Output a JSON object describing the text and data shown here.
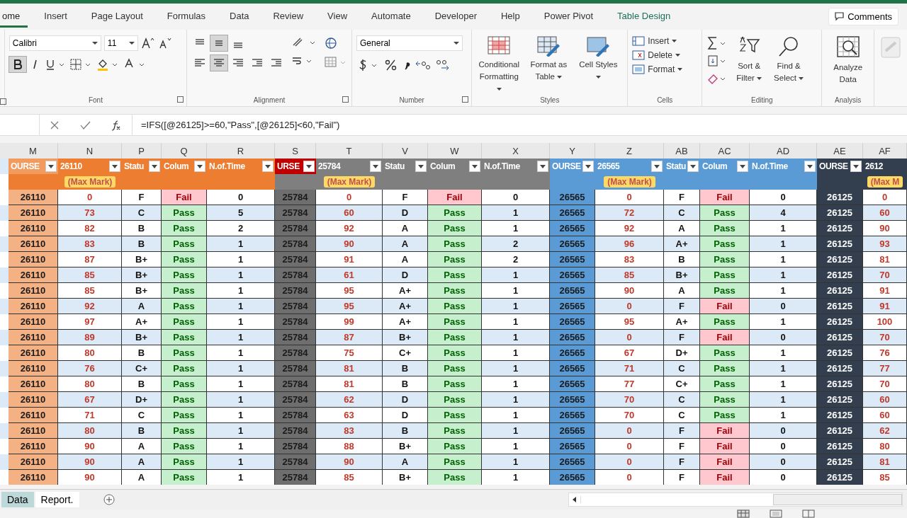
{
  "ribbon": {
    "tabs": [
      {
        "label": "ome",
        "selected": true
      },
      {
        "label": "Insert",
        "selected": false
      },
      {
        "label": "Page Layout",
        "selected": false
      },
      {
        "label": "Formulas",
        "selected": false
      },
      {
        "label": "Data",
        "selected": false
      },
      {
        "label": "Review",
        "selected": false
      },
      {
        "label": "View",
        "selected": false
      },
      {
        "label": "Automate",
        "selected": false
      },
      {
        "label": "Developer",
        "selected": false
      },
      {
        "label": "Help",
        "selected": false
      },
      {
        "label": "Power Pivot",
        "selected": false
      },
      {
        "label": "Table Design",
        "selected": false
      }
    ],
    "comments_button": "Comments",
    "font": {
      "label": "Font",
      "name": "Calibri",
      "size": "11",
      "bold": true
    },
    "alignment": {
      "label": "Alignment",
      "buttons": [
        {
          "kind": "top",
          "selected": false
        },
        {
          "kind": "middle",
          "selected": true
        },
        {
          "kind": "bottom",
          "selected": false
        },
        {
          "kind": "left",
          "selected": false
        },
        {
          "kind": "center",
          "selected": true
        },
        {
          "kind": "right",
          "selected": false
        },
        {
          "kind": "outdent",
          "selected": false
        },
        {
          "kind": "indent",
          "selected": false
        }
      ]
    },
    "number": {
      "label": "Number",
      "format": "General"
    },
    "styles": {
      "label": "Styles",
      "buttons": [
        {
          "kind": "conditional",
          "label": "Conditional Formatting"
        },
        {
          "kind": "table",
          "label": "Format as Table"
        },
        {
          "kind": "cellstyles",
          "label": "Cell Styles"
        }
      ]
    },
    "cells": {
      "label": "Cells",
      "buttons": [
        {
          "kind": "insert",
          "label": "Insert"
        },
        {
          "kind": "delete",
          "label": "Delete"
        },
        {
          "kind": "format",
          "label": "Format"
        }
      ]
    },
    "editing": {
      "label": "Editing",
      "buttons": [
        {
          "kind": "sort",
          "label": "Sort & Filter"
        },
        {
          "kind": "find",
          "label": "Find & Select"
        }
      ]
    },
    "analysis": {
      "label": "Analysis",
      "button": "Analyze Data"
    }
  },
  "formula_bar": {
    "formula": "=IFS([@26125]>=60,\"Pass\",[@26125]<60,\"Fail\")"
  },
  "table": {
    "blocks": [
      {
        "color": "#ed7d31",
        "code_column": {
          "color": "#f4b183"
        },
        "letters": [
          "M",
          "N",
          "P",
          "Q",
          "R"
        ],
        "headers": [
          {
            "label": "OURSE",
            "color": "#f29b5e",
            "filter": true
          },
          {
            "label": "26110",
            "color": "#ed7d31",
            "filter": true
          },
          {
            "label": "Statu",
            "color": "#ed7d31",
            "filter": true
          },
          {
            "label": "Colum",
            "color": "#ed7d31",
            "filter": true
          },
          {
            "label": "N.of.Time",
            "color": "#ed7d31",
            "filter": true
          }
        ],
        "subheader": "(Max Mark)"
      },
      {
        "color": "#7f7f7f",
        "code_column": {
          "color": "#6e6e6e"
        },
        "letters": [
          "S",
          "T",
          "V",
          "W",
          "X"
        ],
        "headers": [
          {
            "label": "URSE",
            "color": "#c00000",
            "filter": true
          },
          {
            "label": "25784",
            "color": "#7f7f7f",
            "filter": true
          },
          {
            "label": "Statu",
            "color": "#7f7f7f",
            "filter": true
          },
          {
            "label": "Colum",
            "color": "#7f7f7f",
            "filter": true
          },
          {
            "label": "N.of.Time",
            "color": "#7f7f7f",
            "filter": true
          }
        ],
        "subheader": "(Max Mark)"
      },
      {
        "color": "#5b9bd5",
        "code_column": {
          "color": "#5b9bd5"
        },
        "letters": [
          "Y",
          "Z",
          "AB",
          "AC",
          "AD"
        ],
        "headers": [
          {
            "label": "OURSE",
            "color": "#5b9bd5",
            "filter": true
          },
          {
            "label": "26565",
            "color": "#5b9bd5",
            "filter": true
          },
          {
            "label": "Statu",
            "color": "#5b9bd5",
            "filter": true
          },
          {
            "label": "Colum",
            "color": "#5b9bd5",
            "filter": true
          },
          {
            "label": "N.of.Time",
            "color": "#5b9bd5",
            "filter": true
          }
        ],
        "subheader": "(Max Mark)"
      },
      {
        "color": "#333f4f",
        "code_column": {
          "color": "#333f4f"
        },
        "letters": [
          "AE",
          "AF"
        ],
        "headers": [
          {
            "label": "OURSE",
            "color": "#333f4f",
            "filter": true
          },
          {
            "label": "2612",
            "color": "#333f4f",
            "filter": false
          }
        ],
        "subheader": "(Max M"
      }
    ],
    "rows": [
      {
        "groups": [
          {
            "code": "26110",
            "mark": "0",
            "grade": "F",
            "result": "Fail",
            "pass": false,
            "times": "0"
          },
          {
            "code": "25784",
            "mark": "0",
            "grade": "F",
            "result": "Fail",
            "pass": false,
            "times": "0"
          },
          {
            "code": "26565",
            "mark": "0",
            "grade": "F",
            "result": "Fail",
            "pass": false,
            "times": "0"
          },
          {
            "code": "26125",
            "mark": "0"
          }
        ]
      },
      {
        "groups": [
          {
            "code": "26110",
            "mark": "73",
            "grade": "C",
            "result": "Pass",
            "pass": true,
            "times": "5"
          },
          {
            "code": "25784",
            "mark": "60",
            "grade": "D",
            "result": "Pass",
            "pass": true,
            "times": "1"
          },
          {
            "code": "26565",
            "mark": "72",
            "grade": "C",
            "result": "Pass",
            "pass": true,
            "times": "4"
          },
          {
            "code": "26125",
            "mark": "60"
          }
        ]
      },
      {
        "groups": [
          {
            "code": "26110",
            "mark": "82",
            "grade": "B",
            "result": "Pass",
            "pass": true,
            "times": "2"
          },
          {
            "code": "25784",
            "mark": "92",
            "grade": "A",
            "result": "Pass",
            "pass": true,
            "times": "1"
          },
          {
            "code": "26565",
            "mark": "92",
            "grade": "A",
            "result": "Pass",
            "pass": true,
            "times": "1"
          },
          {
            "code": "26125",
            "mark": "90"
          }
        ]
      },
      {
        "groups": [
          {
            "code": "26110",
            "mark": "83",
            "grade": "B",
            "result": "Pass",
            "pass": true,
            "times": "1"
          },
          {
            "code": "25784",
            "mark": "90",
            "grade": "A",
            "result": "Pass",
            "pass": true,
            "times": "2"
          },
          {
            "code": "26565",
            "mark": "96",
            "grade": "A+",
            "result": "Pass",
            "pass": true,
            "times": "1"
          },
          {
            "code": "26125",
            "mark": "93"
          }
        ]
      },
      {
        "groups": [
          {
            "code": "26110",
            "mark": "87",
            "grade": "B+",
            "result": "Pass",
            "pass": true,
            "times": "1"
          },
          {
            "code": "25784",
            "mark": "91",
            "grade": "A",
            "result": "Pass",
            "pass": true,
            "times": "2"
          },
          {
            "code": "26565",
            "mark": "83",
            "grade": "B",
            "result": "Pass",
            "pass": true,
            "times": "1"
          },
          {
            "code": "26125",
            "mark": "81"
          }
        ]
      },
      {
        "groups": [
          {
            "code": "26110",
            "mark": "85",
            "grade": "B+",
            "result": "Pass",
            "pass": true,
            "times": "1"
          },
          {
            "code": "25784",
            "mark": "61",
            "grade": "D",
            "result": "Pass",
            "pass": true,
            "times": "1"
          },
          {
            "code": "26565",
            "mark": "85",
            "grade": "B+",
            "result": "Pass",
            "pass": true,
            "times": "1"
          },
          {
            "code": "26125",
            "mark": "70"
          }
        ]
      },
      {
        "groups": [
          {
            "code": "26110",
            "mark": "85",
            "grade": "B+",
            "result": "Pass",
            "pass": true,
            "times": "1"
          },
          {
            "code": "25784",
            "mark": "95",
            "grade": "A+",
            "result": "Pass",
            "pass": true,
            "times": "1"
          },
          {
            "code": "26565",
            "mark": "90",
            "grade": "A",
            "result": "Pass",
            "pass": true,
            "times": "1"
          },
          {
            "code": "26125",
            "mark": "91"
          }
        ]
      },
      {
        "groups": [
          {
            "code": "26110",
            "mark": "92",
            "grade": "A",
            "result": "Pass",
            "pass": true,
            "times": "1"
          },
          {
            "code": "25784",
            "mark": "95",
            "grade": "A+",
            "result": "Pass",
            "pass": true,
            "times": "1"
          },
          {
            "code": "26565",
            "mark": "0",
            "grade": "F",
            "result": "Fail",
            "pass": false,
            "times": "0"
          },
          {
            "code": "26125",
            "mark": "91"
          }
        ]
      },
      {
        "groups": [
          {
            "code": "26110",
            "mark": "97",
            "grade": "A+",
            "result": "Pass",
            "pass": true,
            "times": "1"
          },
          {
            "code": "25784",
            "mark": "99",
            "grade": "A+",
            "result": "Pass",
            "pass": true,
            "times": "1"
          },
          {
            "code": "26565",
            "mark": "95",
            "grade": "A+",
            "result": "Pass",
            "pass": true,
            "times": "1"
          },
          {
            "code": "26125",
            "mark": "100"
          }
        ]
      },
      {
        "groups": [
          {
            "code": "26110",
            "mark": "89",
            "grade": "B+",
            "result": "Pass",
            "pass": true,
            "times": "1"
          },
          {
            "code": "25784",
            "mark": "87",
            "grade": "B+",
            "result": "Pass",
            "pass": true,
            "times": "1"
          },
          {
            "code": "26565",
            "mark": "0",
            "grade": "F",
            "result": "Fail",
            "pass": false,
            "times": "0"
          },
          {
            "code": "26125",
            "mark": "70"
          }
        ]
      },
      {
        "groups": [
          {
            "code": "26110",
            "mark": "80",
            "grade": "B",
            "result": "Pass",
            "pass": true,
            "times": "1"
          },
          {
            "code": "25784",
            "mark": "75",
            "grade": "C+",
            "result": "Pass",
            "pass": true,
            "times": "1"
          },
          {
            "code": "26565",
            "mark": "67",
            "grade": "D+",
            "result": "Pass",
            "pass": true,
            "times": "1"
          },
          {
            "code": "26125",
            "mark": "76"
          }
        ]
      },
      {
        "groups": [
          {
            "code": "26110",
            "mark": "76",
            "grade": "C+",
            "result": "Pass",
            "pass": true,
            "times": "1"
          },
          {
            "code": "25784",
            "mark": "81",
            "grade": "B",
            "result": "Pass",
            "pass": true,
            "times": "1"
          },
          {
            "code": "26565",
            "mark": "71",
            "grade": "C",
            "result": "Pass",
            "pass": true,
            "times": "1"
          },
          {
            "code": "26125",
            "mark": "77"
          }
        ]
      },
      {
        "groups": [
          {
            "code": "26110",
            "mark": "80",
            "grade": "B",
            "result": "Pass",
            "pass": true,
            "times": "1"
          },
          {
            "code": "25784",
            "mark": "81",
            "grade": "B",
            "result": "Pass",
            "pass": true,
            "times": "1"
          },
          {
            "code": "26565",
            "mark": "77",
            "grade": "C+",
            "result": "Pass",
            "pass": true,
            "times": "1"
          },
          {
            "code": "26125",
            "mark": "70"
          }
        ]
      },
      {
        "groups": [
          {
            "code": "26110",
            "mark": "67",
            "grade": "D+",
            "result": "Pass",
            "pass": true,
            "times": "1"
          },
          {
            "code": "25784",
            "mark": "62",
            "grade": "D",
            "result": "Pass",
            "pass": true,
            "times": "1"
          },
          {
            "code": "26565",
            "mark": "70",
            "grade": "C",
            "result": "Pass",
            "pass": true,
            "times": "1"
          },
          {
            "code": "26125",
            "mark": "60"
          }
        ]
      },
      {
        "groups": [
          {
            "code": "26110",
            "mark": "71",
            "grade": "C",
            "result": "Pass",
            "pass": true,
            "times": "1"
          },
          {
            "code": "25784",
            "mark": "63",
            "grade": "D",
            "result": "Pass",
            "pass": true,
            "times": "1"
          },
          {
            "code": "26565",
            "mark": "70",
            "grade": "C",
            "result": "Pass",
            "pass": true,
            "times": "1"
          },
          {
            "code": "26125",
            "mark": "60"
          }
        ]
      },
      {
        "groups": [
          {
            "code": "26110",
            "mark": "80",
            "grade": "B",
            "result": "Pass",
            "pass": true,
            "times": "1"
          },
          {
            "code": "25784",
            "mark": "83",
            "grade": "B",
            "result": "Pass",
            "pass": true,
            "times": "1"
          },
          {
            "code": "26565",
            "mark": "0",
            "grade": "F",
            "result": "Fail",
            "pass": false,
            "times": "0"
          },
          {
            "code": "26125",
            "mark": "62"
          }
        ]
      },
      {
        "groups": [
          {
            "code": "26110",
            "mark": "90",
            "grade": "A",
            "result": "Pass",
            "pass": true,
            "times": "1"
          },
          {
            "code": "25784",
            "mark": "88",
            "grade": "B+",
            "result": "Pass",
            "pass": true,
            "times": "1"
          },
          {
            "code": "26565",
            "mark": "0",
            "grade": "F",
            "result": "Fail",
            "pass": false,
            "times": "0"
          },
          {
            "code": "26125",
            "mark": "80"
          }
        ]
      },
      {
        "groups": [
          {
            "code": "26110",
            "mark": "90",
            "grade": "A",
            "result": "Pass",
            "pass": true,
            "times": "1"
          },
          {
            "code": "25784",
            "mark": "90",
            "grade": "A",
            "result": "Pass",
            "pass": true,
            "times": "1"
          },
          {
            "code": "26565",
            "mark": "0",
            "grade": "F",
            "result": "Fail",
            "pass": false,
            "times": "0"
          },
          {
            "code": "26125",
            "mark": "81"
          }
        ]
      },
      {
        "groups": [
          {
            "code": "26110",
            "mark": "90",
            "grade": "A",
            "result": "Pass",
            "pass": true,
            "times": "1"
          },
          {
            "code": "25784",
            "mark": "85",
            "grade": "B+",
            "result": "Pass",
            "pass": true,
            "times": "1"
          },
          {
            "code": "26565",
            "mark": "0",
            "grade": "F",
            "result": "Fail",
            "pass": false,
            "times": "0"
          },
          {
            "code": "26125",
            "mark": "85"
          }
        ]
      }
    ]
  },
  "sheet_tabs": [
    {
      "label": "Data",
      "selected": true
    },
    {
      "label": "Report.",
      "selected": false
    }
  ]
}
